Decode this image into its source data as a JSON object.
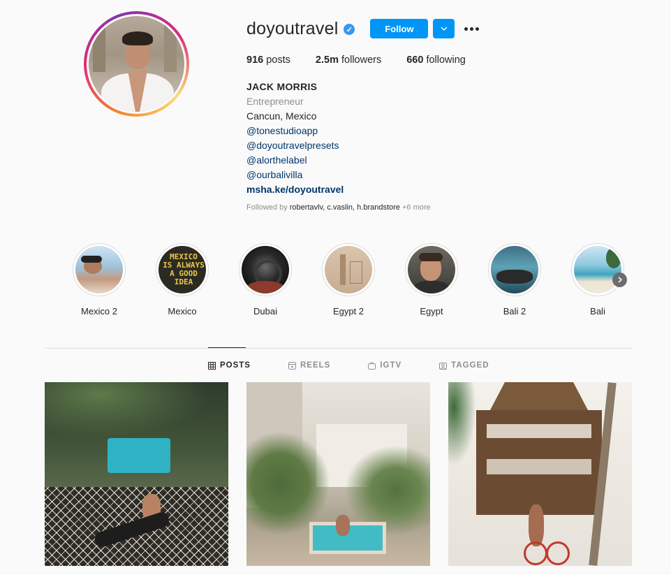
{
  "profile": {
    "username": "doyoutravel",
    "verified_glyph": "✓",
    "follow_label": "Follow",
    "stats": [
      {
        "value": "916",
        "label": "posts"
      },
      {
        "value": "2.5m",
        "label": "followers"
      },
      {
        "value": "660",
        "label": "following"
      }
    ],
    "bio": {
      "name": "JACK MORRIS",
      "category": "Entrepreneur",
      "location": "Cancun, Mexico",
      "mentions": [
        "@tonestudioapp",
        "@doyoutravelpresets",
        "@alorthelabel",
        "@ourbalivilla"
      ],
      "website": "msha.ke/doyoutravel"
    },
    "followed_by": {
      "prefix": "Followed by",
      "users": "robertavlv, c.vaslin, h.brandstore",
      "more": "+6 more"
    }
  },
  "highlights": [
    {
      "label": "Mexico 2"
    },
    {
      "label": "Mexico",
      "sign_text": [
        "MEXICO",
        "IS ALWAYS",
        "A GOOD",
        "IDEA"
      ]
    },
    {
      "label": "Dubai"
    },
    {
      "label": "Egypt 2"
    },
    {
      "label": "Egypt"
    },
    {
      "label": "Bali 2"
    },
    {
      "label": "Bali"
    }
  ],
  "tabs": [
    {
      "label": "POSTS",
      "icon": "grid-icon",
      "active": true
    },
    {
      "label": "REELS",
      "icon": "reels-icon",
      "active": false
    },
    {
      "label": "IGTV",
      "icon": "igtv-icon",
      "active": false
    },
    {
      "label": "TAGGED",
      "icon": "tagged-icon",
      "active": false
    }
  ],
  "colors": {
    "accent": "#0095f6",
    "verified": "#3897f0",
    "link": "#00376b",
    "muted": "#8e8e8e",
    "text": "#262626",
    "background": "#fafafa"
  }
}
